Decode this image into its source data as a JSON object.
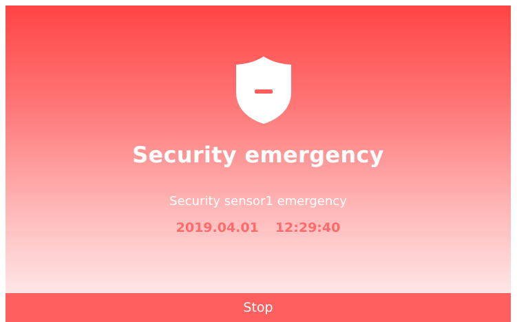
{
  "alert": {
    "icon": "shield-minus-icon",
    "title": "Security emergency",
    "message": "Security sensor1 emergency",
    "date": "2019.04.01",
    "time": "12:29:40"
  },
  "actions": {
    "stop_label": "Stop"
  },
  "colors": {
    "primary": "#ff4444",
    "button": "#ff5f5f",
    "datetime": "#ff6b6b",
    "text_on_alert": "#ffffff"
  }
}
